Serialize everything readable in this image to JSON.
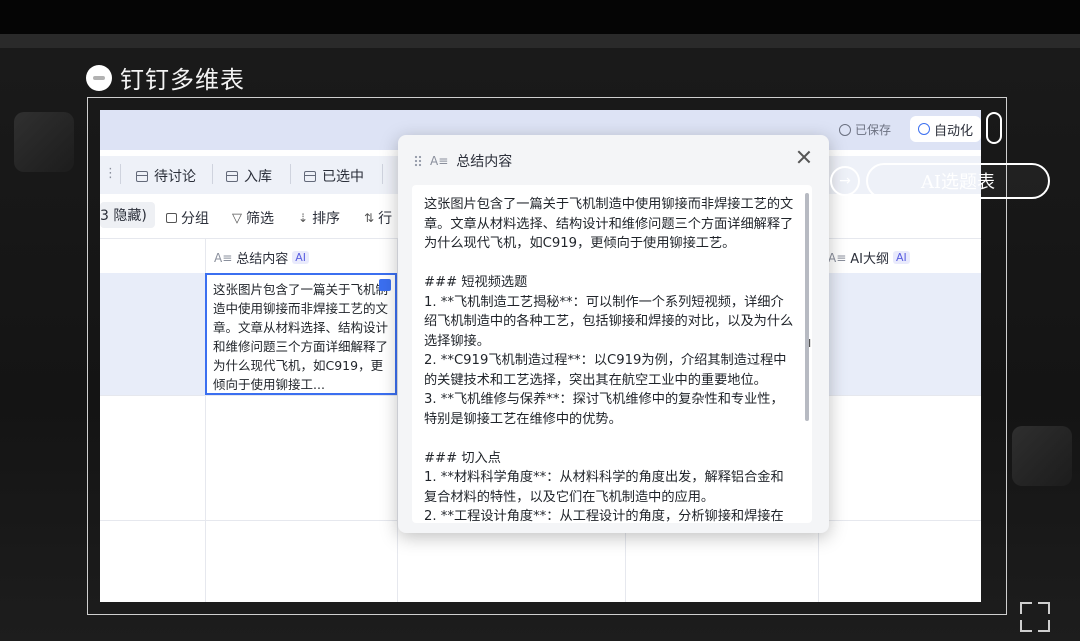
{
  "brand": {
    "title": "钉钉多维表"
  },
  "header": {
    "saved": "已保存",
    "auto": "自动化"
  },
  "tabs": [
    {
      "label": "待讨论"
    },
    {
      "label": "入库"
    },
    {
      "label": "已选中"
    }
  ],
  "toolbar": {
    "hidden": "3 隐藏)",
    "group": "分组",
    "filter": "筛选",
    "sort": "排序",
    "row": "行"
  },
  "columns": {
    "summary": "总结内容",
    "ai_tag": "AI",
    "outline": "AI大纲"
  },
  "cell": {
    "text": "这张图片包含了一篇关于飞机制造中使用铆接而非焊接工艺的文章。文章从材料选择、结构设计和维修问题三个方面详细解释了为什么现代飞机，如C919，更倾向于使用铆接工..."
  },
  "modal": {
    "title": "总结内容",
    "body": "这张图片包含了一篇关于飞机制造中使用铆接而非焊接工艺的文章。文章从材料选择、结构设计和维修问题三个方面详细解释了为什么现代飞机，如C919，更倾向于使用铆接工艺。\n\n### 短视频选题\n1. **飞机制造工艺揭秘**：可以制作一个系列短视频，详细介绍飞机制造中的各种工艺，包括铆接和焊接的对比，以及为什么选择铆接。\n2. **C919飞机制造过程**：以C919为例，介绍其制造过程中的关键技术和工艺选择，突出其在航空工业中的重要地位。\n3. **飞机维修与保养**：探讨飞机维修中的复杂性和专业性，特别是铆接工艺在维修中的优势。\n\n### 切入点\n1. **材料科学角度**：从材料科学的角度出发，解释铝合金和复合材料的特性，以及它们在飞机制造中的应用。\n2. **工程设计角度**：从工程设计的角度，分析铆接和焊接在"
  },
  "side": {
    "pill": "AI选题表",
    "arrow": "→"
  },
  "colors": {
    "accent": "#3b6ff0",
    "header": "#dde3f5"
  }
}
